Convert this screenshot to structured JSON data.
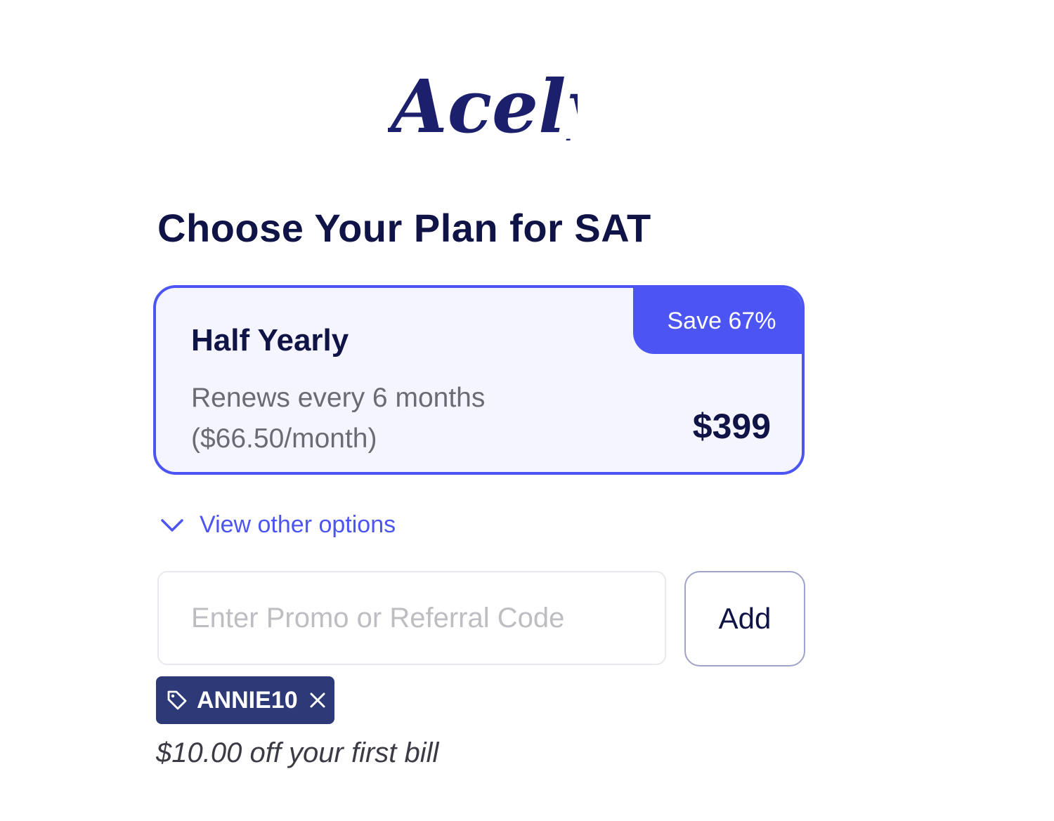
{
  "brand": {
    "name": "Acely",
    "color": "#1c1f6b"
  },
  "page": {
    "title": "Choose Your Plan for SAT"
  },
  "plan": {
    "name": "Half Yearly",
    "badge": "Save 67%",
    "description_line1": "Renews every 6 months",
    "description_line2": "($66.50/month)",
    "price": "$399",
    "accent_color": "#4c55f4",
    "selected": true
  },
  "options_toggle": {
    "label": "View other options",
    "icon": "chevron-down-icon"
  },
  "promo": {
    "placeholder": "Enter Promo or Referral Code",
    "value": "",
    "add_label": "Add",
    "applied_code": "ANNIE10",
    "chip_icon": "tag-icon",
    "remove_icon": "close-icon",
    "discount_text": "$10.00 off your first bill"
  }
}
